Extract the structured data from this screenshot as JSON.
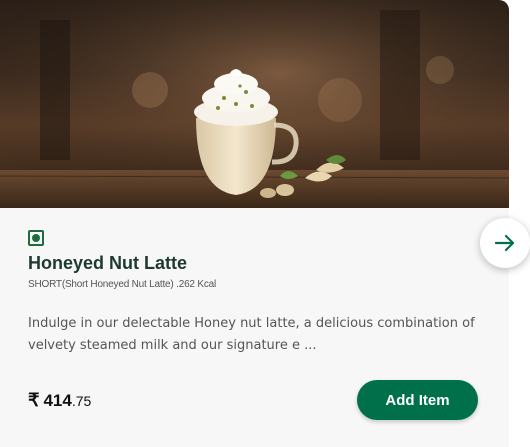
{
  "product": {
    "image_alt_icon": "latte-image",
    "veg_icon": "veg-indicator-icon",
    "name": "Honeyed Nut Latte",
    "subtitle": "SHORT(Short Honeyed Nut Latte) .262 Kcal",
    "description": "Indulge in our delectable Honey nut latte, a delicious combination of velvety steamed milk and our signature e ...",
    "price_currency": "₹",
    "price_main": "414",
    "price_decimal": ".75"
  },
  "actions": {
    "add_label": "Add Item",
    "next_icon": "arrow-right-icon"
  },
  "colors": {
    "brand_green": "#00704a",
    "title_green": "#1e3932",
    "veg_green": "#1e6b3d"
  }
}
